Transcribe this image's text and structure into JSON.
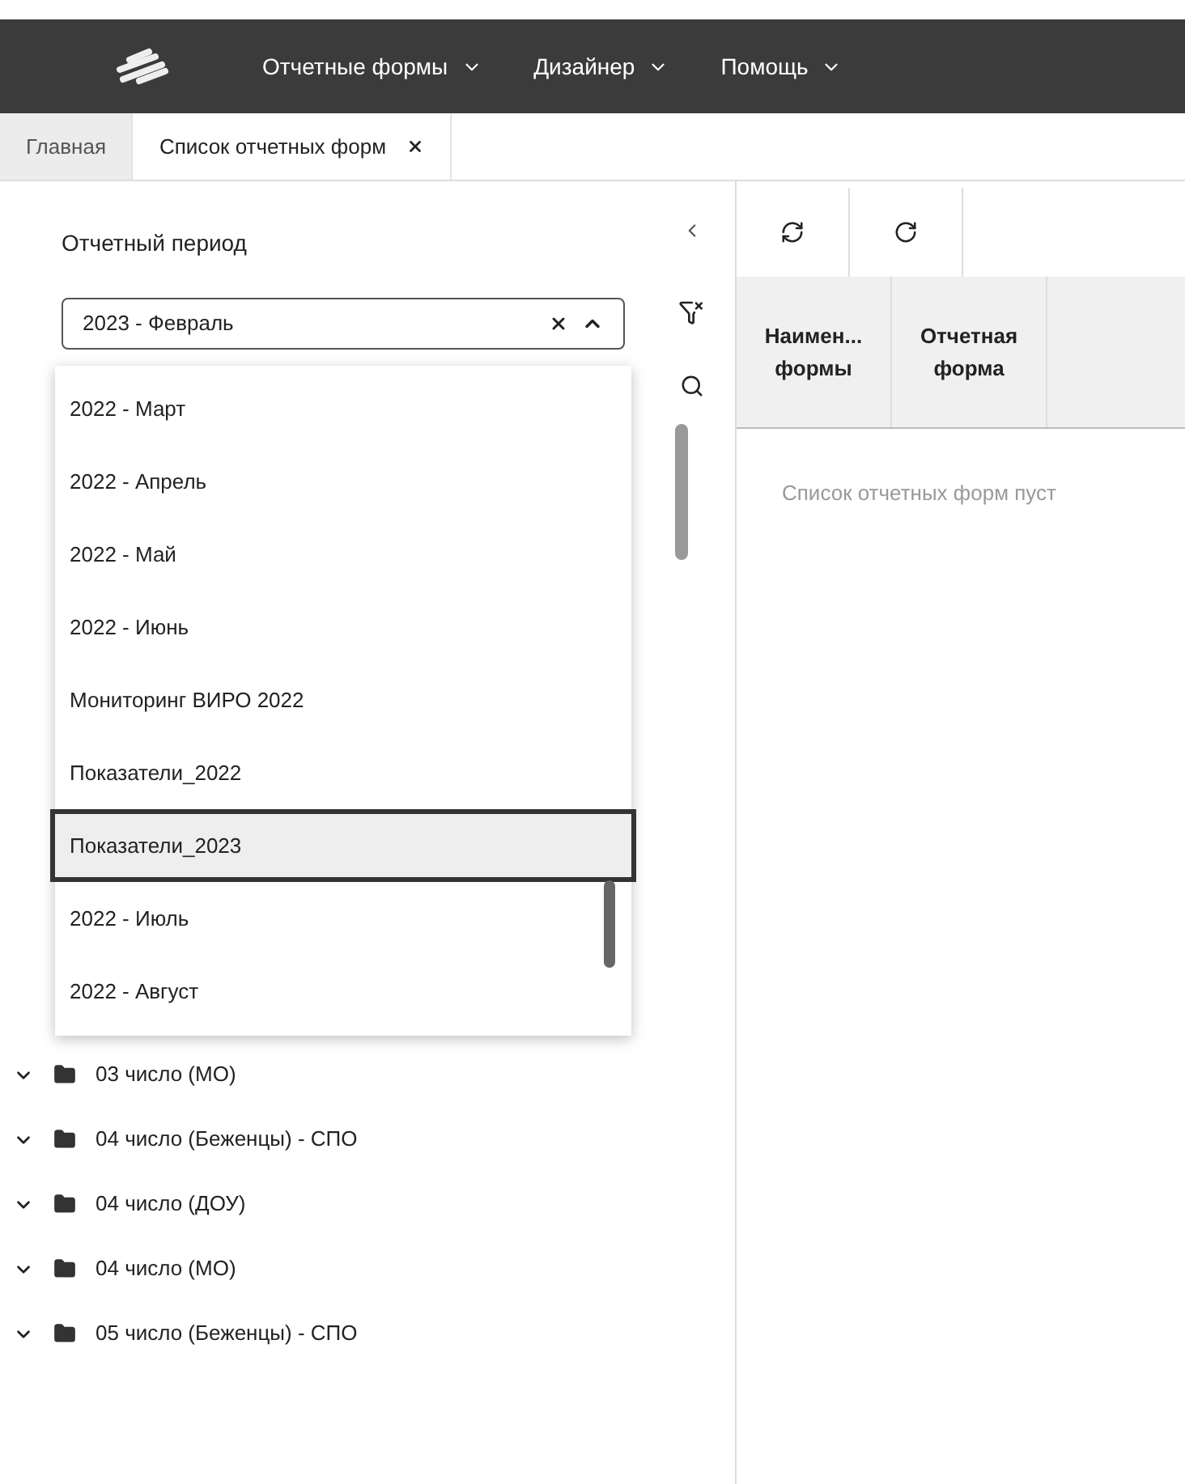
{
  "nav": {
    "menus": [
      {
        "label": "Отчетные формы"
      },
      {
        "label": "Дизайнер"
      },
      {
        "label": "Помощь"
      }
    ]
  },
  "tabs": [
    {
      "label": "Главная",
      "selected": false,
      "closable": false
    },
    {
      "label": "Список отчетных форм",
      "selected": true,
      "closable": true
    }
  ],
  "filter_panel": {
    "title": "Отчетный период",
    "select": {
      "value": "2023 - Февраль",
      "expanded": true,
      "options": [
        {
          "label": "2022 - Март",
          "selected": false
        },
        {
          "label": "2022 - Апрель",
          "selected": false
        },
        {
          "label": "2022 - Май",
          "selected": false
        },
        {
          "label": "2022 - Июнь",
          "selected": false
        },
        {
          "label": "Мониторинг ВИРО 2022",
          "selected": false
        },
        {
          "label": "Показатели_2022",
          "selected": false
        },
        {
          "label": "Показатели_2023",
          "selected": true
        },
        {
          "label": "2022 - Июль",
          "selected": false
        },
        {
          "label": "2022 - Август",
          "selected": false
        }
      ]
    }
  },
  "tree": {
    "items": [
      {
        "label": "03 число (МО)",
        "expanded": true
      },
      {
        "label": "04 число (Беженцы) - СПО",
        "expanded": true
      },
      {
        "label": "04 число (ДОУ)",
        "expanded": true
      },
      {
        "label": "04 число (МО)",
        "expanded": true
      },
      {
        "label": "05 число (Беженцы) - СПО",
        "expanded": true
      }
    ]
  },
  "table": {
    "columns": [
      "Наимен... формы",
      "Отчетная форма"
    ],
    "empty_text": "Список отчетных форм пуст"
  }
}
